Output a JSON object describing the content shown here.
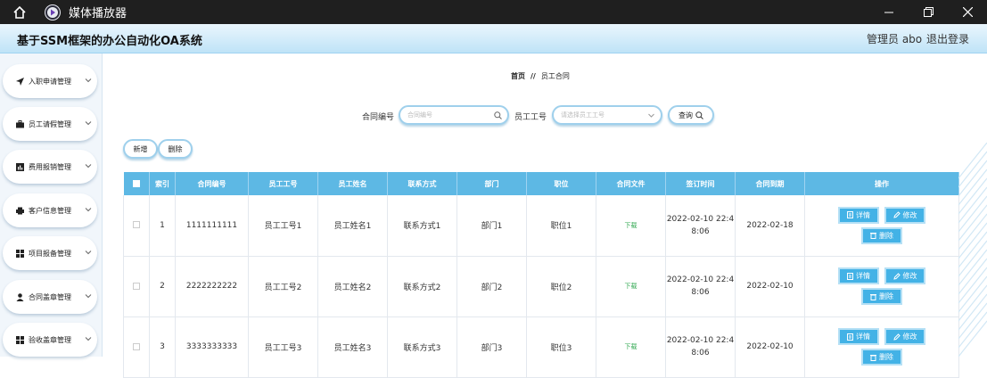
{
  "window": {
    "title": "媒体播放器"
  },
  "header": {
    "app_title": "基于SSM框架的办公自动化OA系统",
    "user": "管理员 abo",
    "logout": "退出登录"
  },
  "sidebar": {
    "items": [
      {
        "label": "入职申请管理",
        "icon": "send-icon"
      },
      {
        "label": "员工请假管理",
        "icon": "briefcase-icon"
      },
      {
        "label": "费用报销管理",
        "icon": "chart-icon"
      },
      {
        "label": "客户信息管理",
        "icon": "printer-icon"
      },
      {
        "label": "项目报备管理",
        "icon": "grid-icon"
      },
      {
        "label": "合同盖章管理",
        "icon": "user-icon"
      },
      {
        "label": "验收盖章管理",
        "icon": "grid-icon"
      }
    ]
  },
  "breadcrumb": {
    "home": "首页",
    "separator": "//",
    "current": "员工合同"
  },
  "search": {
    "contract_label": "合同编号",
    "contract_placeholder": "合同编号",
    "employee_label": "员工工号",
    "employee_placeholder": "请选择员工工号",
    "query_button": "查询"
  },
  "actions": {
    "add": "新增",
    "delete": "删除"
  },
  "table": {
    "columns": [
      "索引",
      "合同编号",
      "员工工号",
      "员工姓名",
      "联系方式",
      "部门",
      "职位",
      "合同文件",
      "签订时间",
      "合同到期",
      "操作"
    ],
    "rows": [
      {
        "index": "1",
        "contract_no": "1111111111",
        "emp_no": "员工工号1",
        "emp_name": "员工姓名1",
        "contact": "联系方式1",
        "dept": "部门1",
        "position": "职位1",
        "file": "下载",
        "sign_l1": "2022-02-10 22:4",
        "sign_l2": "8:06",
        "expire": "2022-02-18"
      },
      {
        "index": "2",
        "contract_no": "2222222222",
        "emp_no": "员工工号2",
        "emp_name": "员工姓名2",
        "contact": "联系方式2",
        "dept": "部门2",
        "position": "职位2",
        "file": "下载",
        "sign_l1": "2022-02-10 22:4",
        "sign_l2": "8:06",
        "expire": "2022-02-10"
      },
      {
        "index": "3",
        "contract_no": "3333333333",
        "emp_no": "员工工号3",
        "emp_name": "员工姓名3",
        "contact": "联系方式3",
        "dept": "部门3",
        "position": "职位3",
        "file": "下载",
        "sign_l1": "2022-02-10 22:4",
        "sign_l2": "8:06",
        "expire": "2022-02-10"
      }
    ],
    "op_detail": "详情",
    "op_edit": "修改",
    "op_delete": "删除"
  },
  "colors": {
    "header_blue": "#5db8e4",
    "op_button": "#43b2e6",
    "download_green": "#32a852"
  }
}
